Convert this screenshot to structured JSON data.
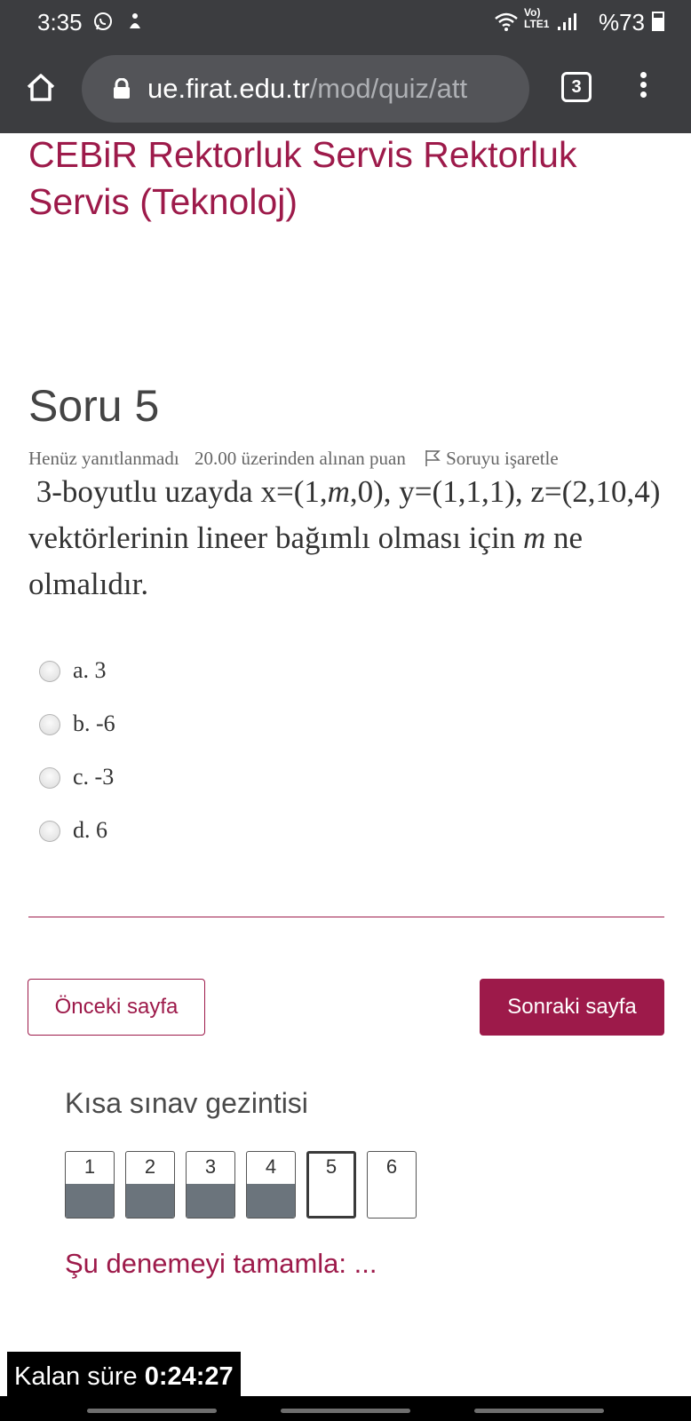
{
  "status_bar": {
    "time": "3:35",
    "network": "Vo) LTE1",
    "battery": "%73"
  },
  "browser": {
    "url_host": "ue.firat.edu.tr",
    "url_path": "/mod/quiz/att",
    "tab_count": "3"
  },
  "course": {
    "title": "CEBiR Rektorluk Servis Rektorluk Servis (Teknoloj)"
  },
  "question": {
    "heading": "Soru 5",
    "status": "Henüz yanıtlanmadı",
    "points": "20.00 üzerinden alınan puan",
    "flag_label": "Soruyu işaretle",
    "text_before": "3-boyutlu uzayda x=(1,",
    "var_m": "m",
    "text_middle": ",0), y=(1,1,1), z=(2,10,4) vektörlerinin lineer bağımlı olması için ",
    "var_m2": "m",
    "text_after": " ne olmalıdır.",
    "options": [
      {
        "label": "a. 3"
      },
      {
        "label": "b. -6"
      },
      {
        "label": "c. -3"
      },
      {
        "label": "d. 6"
      }
    ]
  },
  "navigation": {
    "prev_label": "Önceki sayfa",
    "next_label": "Sonraki sayfa",
    "title": "Kısa sınav gezintisi",
    "questions": [
      {
        "num": "1",
        "state": "answered"
      },
      {
        "num": "2",
        "state": "answered"
      },
      {
        "num": "3",
        "state": "answered"
      },
      {
        "num": "4",
        "state": "answered"
      },
      {
        "num": "5",
        "state": "current"
      },
      {
        "num": "6",
        "state": "unanswered"
      }
    ],
    "finish_label": "Şu denemeyi tamamla: ..."
  },
  "timer": {
    "label": "Kalan süre",
    "value": "0:24:27"
  },
  "colors": {
    "accent": "#9d1a4a",
    "chrome": "#3c3d40",
    "answered_fill": "#6b747c"
  }
}
